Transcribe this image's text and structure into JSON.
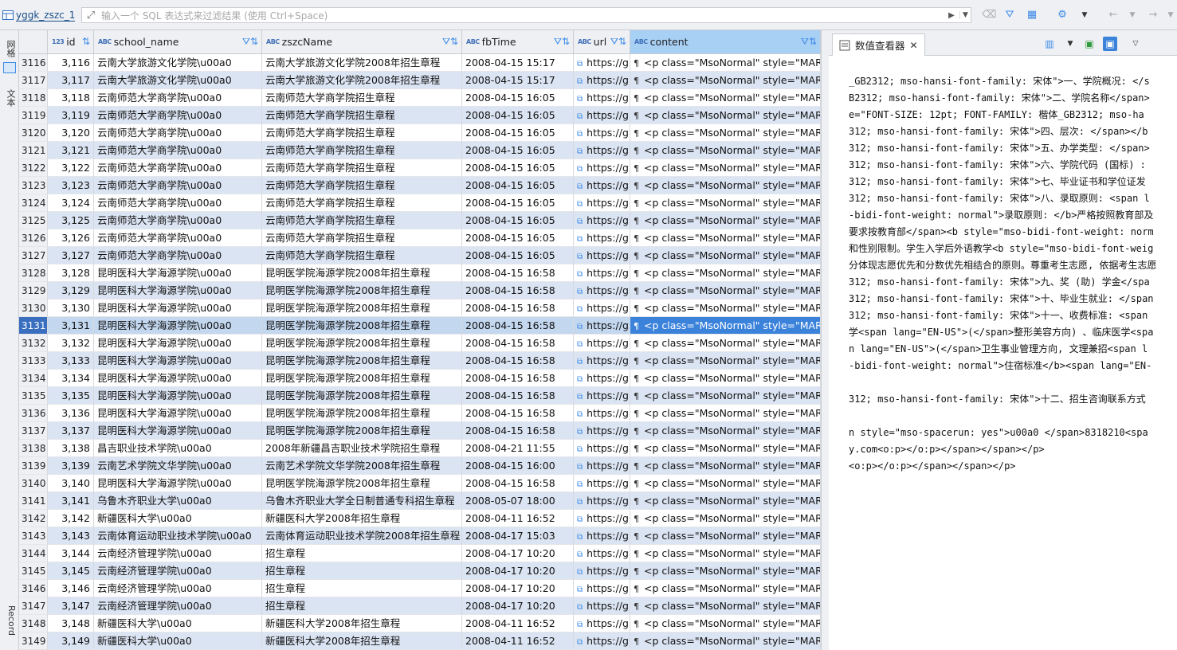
{
  "toolbar": {
    "tab_name": "yggk_zszc_1",
    "filter_placeholder": "输入一个 SQL 表达式来过滤结果 (使用 Ctrl+Space)"
  },
  "left_strip": {
    "grid_label": "网格",
    "text_label": "文本",
    "record_label": "Record"
  },
  "columns": [
    {
      "type": "123",
      "label": "id"
    },
    {
      "type": "ABC",
      "label": "school_name"
    },
    {
      "type": "ABC",
      "label": "zszcName"
    },
    {
      "type": "ABC",
      "label": "fbTime"
    },
    {
      "type": "ABC",
      "label": "url"
    },
    {
      "type": "ABC",
      "label": "content"
    }
  ],
  "rows": [
    {
      "rn": "3116",
      "id": "3,116",
      "school": "云南大学旅游文化学院\\u00a0",
      "name": "云南大学旅游文化学院2008年招生章程",
      "time": "2008-04-15 15:17",
      "url": "https://g",
      "content": "<p class=\"MsoNormal\" style=\"MARGI"
    },
    {
      "rn": "3117",
      "id": "3,117",
      "school": "云南大学旅游文化学院\\u00a0",
      "name": "云南大学旅游文化学院2008年招生章程",
      "time": "2008-04-15 15:17",
      "url": "https://g",
      "content": "<p class=\"MsoNormal\" style=\"MARGI"
    },
    {
      "rn": "3118",
      "id": "3,118",
      "school": "云南师范大学商学院\\u00a0",
      "name": "云南师范大学商学院招生章程",
      "time": "2008-04-15 16:05",
      "url": "https://g",
      "content": "<p class=\"MsoNormal\" style=\"MARGI"
    },
    {
      "rn": "3119",
      "id": "3,119",
      "school": "云南师范大学商学院\\u00a0",
      "name": "云南师范大学商学院招生章程",
      "time": "2008-04-15 16:05",
      "url": "https://g",
      "content": "<p class=\"MsoNormal\" style=\"MARGI"
    },
    {
      "rn": "3120",
      "id": "3,120",
      "school": "云南师范大学商学院\\u00a0",
      "name": "云南师范大学商学院招生章程",
      "time": "2008-04-15 16:05",
      "url": "https://g",
      "content": "<p class=\"MsoNormal\" style=\"MARGI"
    },
    {
      "rn": "3121",
      "id": "3,121",
      "school": "云南师范大学商学院\\u00a0",
      "name": "云南师范大学商学院招生章程",
      "time": "2008-04-15 16:05",
      "url": "https://g",
      "content": "<p class=\"MsoNormal\" style=\"MARGI"
    },
    {
      "rn": "3122",
      "id": "3,122",
      "school": "云南师范大学商学院\\u00a0",
      "name": "云南师范大学商学院招生章程",
      "time": "2008-04-15 16:05",
      "url": "https://g",
      "content": "<p class=\"MsoNormal\" style=\"MARGI"
    },
    {
      "rn": "3123",
      "id": "3,123",
      "school": "云南师范大学商学院\\u00a0",
      "name": "云南师范大学商学院招生章程",
      "time": "2008-04-15 16:05",
      "url": "https://g",
      "content": "<p class=\"MsoNormal\" style=\"MARGI"
    },
    {
      "rn": "3124",
      "id": "3,124",
      "school": "云南师范大学商学院\\u00a0",
      "name": "云南师范大学商学院招生章程",
      "time": "2008-04-15 16:05",
      "url": "https://g",
      "content": "<p class=\"MsoNormal\" style=\"MARGI"
    },
    {
      "rn": "3125",
      "id": "3,125",
      "school": "云南师范大学商学院\\u00a0",
      "name": "云南师范大学商学院招生章程",
      "time": "2008-04-15 16:05",
      "url": "https://g",
      "content": "<p class=\"MsoNormal\" style=\"MARGI"
    },
    {
      "rn": "3126",
      "id": "3,126",
      "school": "云南师范大学商学院\\u00a0",
      "name": "云南师范大学商学院招生章程",
      "time": "2008-04-15 16:05",
      "url": "https://g",
      "content": "<p class=\"MsoNormal\" style=\"MARGI"
    },
    {
      "rn": "3127",
      "id": "3,127",
      "school": "云南师范大学商学院\\u00a0",
      "name": "云南师范大学商学院招生章程",
      "time": "2008-04-15 16:05",
      "url": "https://g",
      "content": "<p class=\"MsoNormal\" style=\"MARGI"
    },
    {
      "rn": "3128",
      "id": "3,128",
      "school": "昆明医科大学海源学院\\u00a0",
      "name": "昆明医学院海源学院2008年招生章程",
      "time": "2008-04-15 16:58",
      "url": "https://g",
      "content": "<p class=\"MsoNormal\" style=\"MARGI"
    },
    {
      "rn": "3129",
      "id": "3,129",
      "school": "昆明医科大学海源学院\\u00a0",
      "name": "昆明医学院海源学院2008年招生章程",
      "time": "2008-04-15 16:58",
      "url": "https://g",
      "content": "<p class=\"MsoNormal\" style=\"MARGI"
    },
    {
      "rn": "3130",
      "id": "3,130",
      "school": "昆明医科大学海源学院\\u00a0",
      "name": "昆明医学院海源学院2008年招生章程",
      "time": "2008-04-15 16:58",
      "url": "https://g",
      "content": "<p class=\"MsoNormal\" style=\"MARGI"
    },
    {
      "rn": "3131",
      "id": "3,131",
      "school": "昆明医科大学海源学院\\u00a0",
      "name": "昆明医学院海源学院2008年招生章程",
      "time": "2008-04-15 16:58",
      "url": "https://g",
      "content": "<p class=\"MsoNormal\" style=\"MARGI",
      "current": true
    },
    {
      "rn": "3132",
      "id": "3,132",
      "school": "昆明医科大学海源学院\\u00a0",
      "name": "昆明医学院海源学院2008年招生章程",
      "time": "2008-04-15 16:58",
      "url": "https://g",
      "content": "<p class=\"MsoNormal\" style=\"MARGI"
    },
    {
      "rn": "3133",
      "id": "3,133",
      "school": "昆明医科大学海源学院\\u00a0",
      "name": "昆明医学院海源学院2008年招生章程",
      "time": "2008-04-15 16:58",
      "url": "https://g",
      "content": "<p class=\"MsoNormal\" style=\"MARGI"
    },
    {
      "rn": "3134",
      "id": "3,134",
      "school": "昆明医科大学海源学院\\u00a0",
      "name": "昆明医学院海源学院2008年招生章程",
      "time": "2008-04-15 16:58",
      "url": "https://g",
      "content": "<p class=\"MsoNormal\" style=\"MARGI"
    },
    {
      "rn": "3135",
      "id": "3,135",
      "school": "昆明医科大学海源学院\\u00a0",
      "name": "昆明医学院海源学院2008年招生章程",
      "time": "2008-04-15 16:58",
      "url": "https://g",
      "content": "<p class=\"MsoNormal\" style=\"MARGI"
    },
    {
      "rn": "3136",
      "id": "3,136",
      "school": "昆明医科大学海源学院\\u00a0",
      "name": "昆明医学院海源学院2008年招生章程",
      "time": "2008-04-15 16:58",
      "url": "https://g",
      "content": "<p class=\"MsoNormal\" style=\"MARGI"
    },
    {
      "rn": "3137",
      "id": "3,137",
      "school": "昆明医科大学海源学院\\u00a0",
      "name": "昆明医学院海源学院2008年招生章程",
      "time": "2008-04-15 16:58",
      "url": "https://g",
      "content": "<p class=\"MsoNormal\" style=\"MARGI"
    },
    {
      "rn": "3138",
      "id": "3,138",
      "school": "昌吉职业技术学院\\u00a0",
      "name": "2008年新疆昌吉职业技术学院招生章程",
      "time": "2008-04-21 11:55",
      "url": "https://g",
      "content": "<p class=\"MsoNormal\" style=\"MARGI"
    },
    {
      "rn": "3139",
      "id": "3,139",
      "school": "云南艺术学院文华学院\\u00a0",
      "name": "云南艺术学院文华学院2008年招生章程",
      "time": "2008-04-15 16:00",
      "url": "https://g",
      "content": "<p class=\"MsoNormal\" style=\"MARGI"
    },
    {
      "rn": "3140",
      "id": "3,140",
      "school": "昆明医科大学海源学院\\u00a0",
      "name": "昆明医学院海源学院2008年招生章程",
      "time": "2008-04-15 16:58",
      "url": "https://g",
      "content": "<p class=\"MsoNormal\" style=\"MARGI"
    },
    {
      "rn": "3141",
      "id": "3,141",
      "school": "乌鲁木齐职业大学\\u00a0",
      "name": "乌鲁木齐职业大学全日制普通专科招生章程",
      "time": "2008-05-07 18:00",
      "url": "https://g",
      "content": "<p class=\"MsoNormal\" style=\"MARGI"
    },
    {
      "rn": "3142",
      "id": "3,142",
      "school": "新疆医科大学\\u00a0",
      "name": "新疆医科大学2008年招生章程",
      "time": "2008-04-11 16:52",
      "url": "https://g",
      "content": "<p class=\"MsoNormal\" style=\"MARGI"
    },
    {
      "rn": "3143",
      "id": "3,143",
      "school": "云南体育运动职业技术学院\\u00a0",
      "name": "云南体育运动职业技术学院2008年招生章程",
      "time": "2008-04-17 15:03",
      "url": "https://g",
      "content": "<p class=\"MsoNormal\" style=\"MARGI"
    },
    {
      "rn": "3144",
      "id": "3,144",
      "school": "云南经济管理学院\\u00a0",
      "name": "招生章程",
      "time": "2008-04-17 10:20",
      "url": "https://g",
      "content": "<p class=\"MsoNormal\" style=\"MARGI"
    },
    {
      "rn": "3145",
      "id": "3,145",
      "school": "云南经济管理学院\\u00a0",
      "name": "招生章程",
      "time": "2008-04-17 10:20",
      "url": "https://g",
      "content": "<p class=\"MsoNormal\" style=\"MARGI"
    },
    {
      "rn": "3146",
      "id": "3,146",
      "school": "云南经济管理学院\\u00a0",
      "name": "招生章程",
      "time": "2008-04-17 10:20",
      "url": "https://g",
      "content": "<p class=\"MsoNormal\" style=\"MARGI"
    },
    {
      "rn": "3147",
      "id": "3,147",
      "school": "云南经济管理学院\\u00a0",
      "name": "招生章程",
      "time": "2008-04-17 10:20",
      "url": "https://g",
      "content": "<p class=\"MsoNormal\" style=\"MARGI"
    },
    {
      "rn": "3148",
      "id": "3,148",
      "school": "新疆医科大学\\u00a0",
      "name": "新疆医科大学2008年招生章程",
      "time": "2008-04-11 16:52",
      "url": "https://g",
      "content": "<p class=\"MsoNormal\" style=\"MARGI"
    },
    {
      "rn": "3149",
      "id": "3,149",
      "school": "新疆医科大学\\u00a0",
      "name": "新疆医科大学2008年招生章程",
      "time": "2008-04-11 16:52",
      "url": "https://g",
      "content": "<p class=\"MsoNormal\" style=\"MARGI"
    }
  ],
  "value_viewer": {
    "title": "数值查看器",
    "lines": [
      "_GB2312; mso-hansi-font-family: 宋体\">一、学院概况: </s",
      "B2312; mso-hansi-font-family: 宋体\">二、学院名称</span>",
      "e=\"FONT-SIZE: 12pt; FONT-FAMILY: 楷体_GB2312; mso-ha",
      "312; mso-hansi-font-family: 宋体\">四、层次: </span></b",
      "312; mso-hansi-font-family: 宋体\">五、办学类型: </span>",
      "312; mso-hansi-font-family: 宋体\">六、学院代码 (国标) :",
      "312; mso-hansi-font-family: 宋体\">七、毕业证书和学位证发",
      "312; mso-hansi-font-family: 宋体\">八、录取原则: <span l",
      "-bidi-font-weight: normal\">录取原则: </b>严格按照教育部及",
      "要求按教育部</span><b style=\"mso-bidi-font-weight: norm",
      "和性别限制。学生入学后外语教学<b style=\"mso-bidi-font-weig",
      "分体现志愿优先和分数优先相结合的原则。尊重考生志愿, 依据考生志愿",
      "312; mso-hansi-font-family: 宋体\">九、奖 (助) 学金</spa",
      "312; mso-hansi-font-family: 宋体\">十、毕业生就业: </span",
      "312; mso-hansi-font-family: 宋体\">十一、收费标准: <span",
      "学<span lang=\"EN-US\">(</span>整形美容方向) 、临床医学<spa",
      "n lang=\"EN-US\">(</span>卫生事业管理方向, 文理兼招<span l",
      "-bidi-font-weight: normal\">住宿标准</b><span lang=\"EN-",
      "",
      "312; mso-hansi-font-family: 宋体\">十二、招生咨询联系方式",
      "",
      "n style=\"mso-spacerun: yes\">u00a0 </span>8318210<spa",
      "y.com<o:p></o:p></span></span></p>",
      "<o:p></o:p></span></span></p>"
    ]
  }
}
